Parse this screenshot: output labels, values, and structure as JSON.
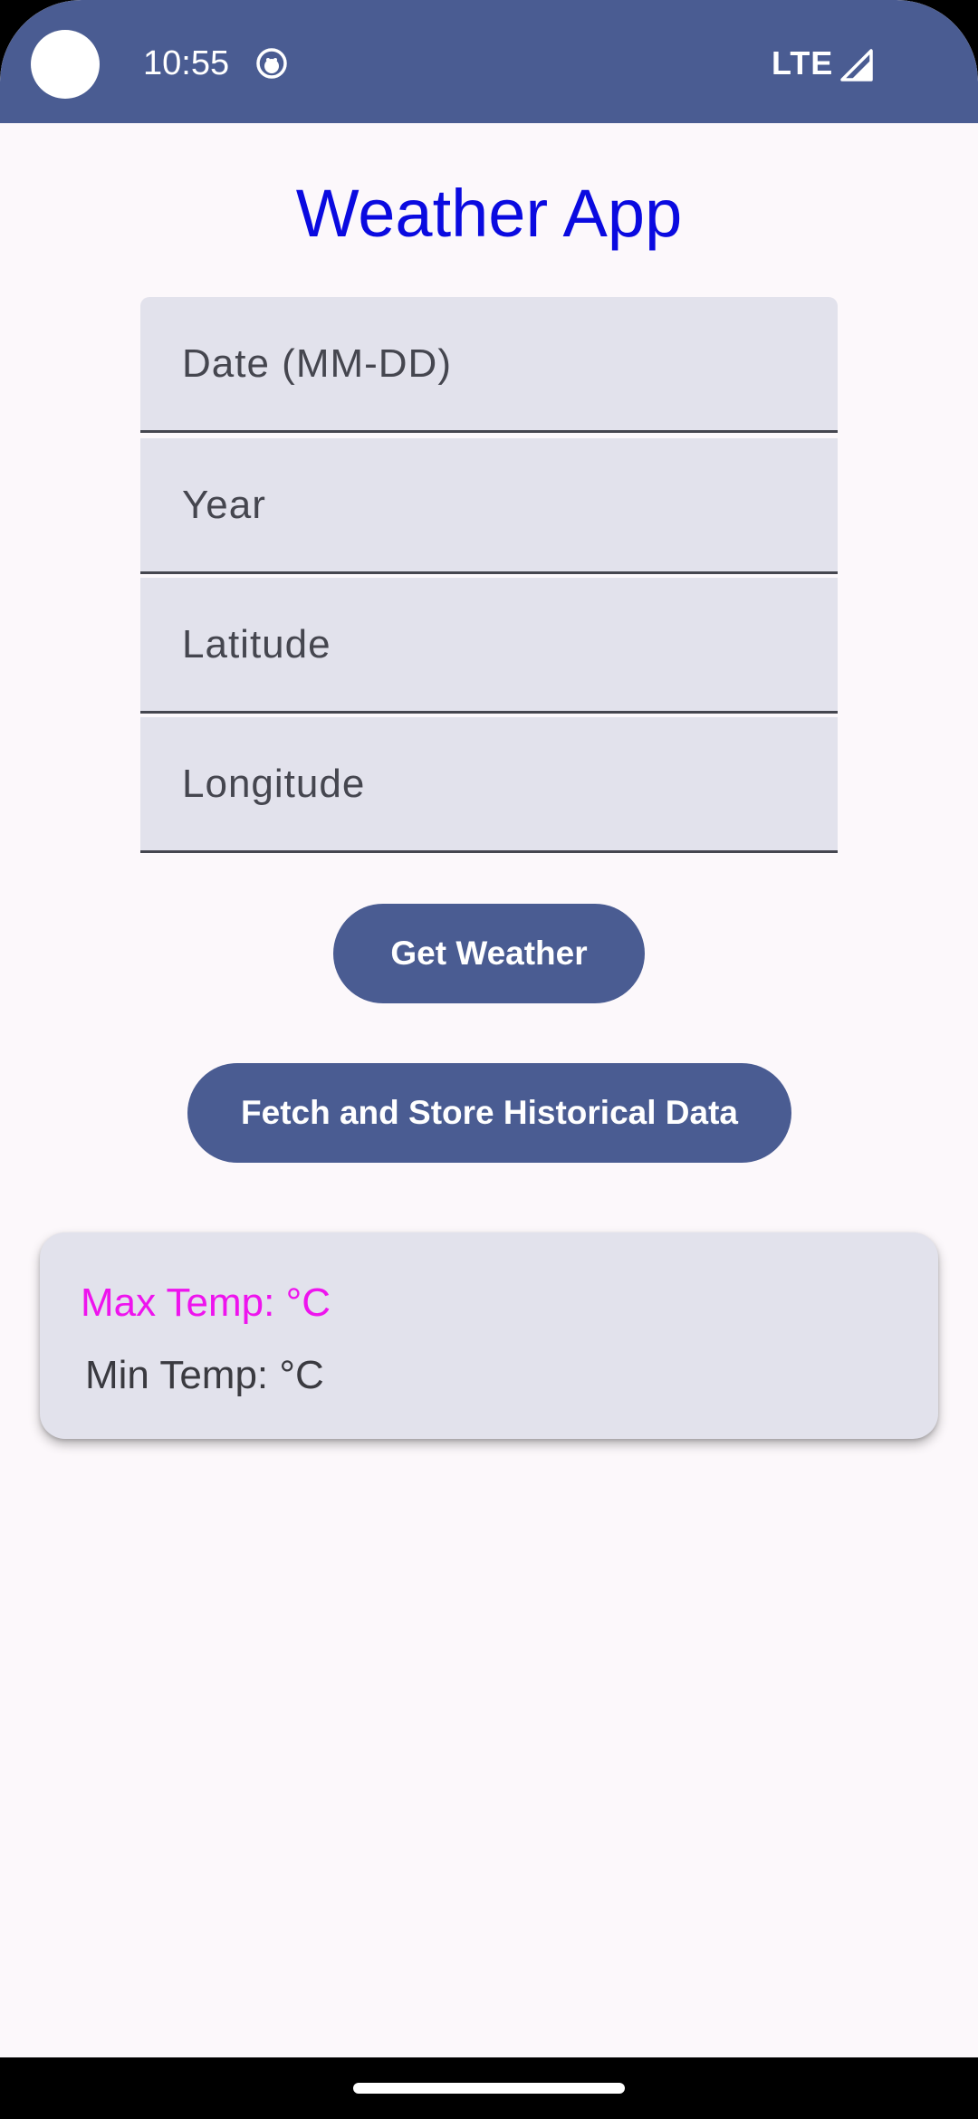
{
  "status_bar": {
    "time": "10:55",
    "network": "LTE",
    "icons": [
      "camera-cutout",
      "face-icon",
      "signal-icon"
    ]
  },
  "app": {
    "title": "Weather App"
  },
  "form": {
    "date_placeholder": "Date (MM-DD)",
    "year_placeholder": "Year",
    "latitude_placeholder": "Latitude",
    "longitude_placeholder": "Longitude",
    "date_value": "",
    "year_value": "",
    "latitude_value": "",
    "longitude_value": ""
  },
  "buttons": {
    "get_weather": "Get Weather",
    "fetch_store": "Fetch and Store Historical Data"
  },
  "result": {
    "max_temp": "Max Temp: °C",
    "min_temp": "Min Temp: °C"
  },
  "colors": {
    "primary": "#4A5C92",
    "title": "#0A0AE0",
    "max_temp": "#EE14EE",
    "surface": "#E2E2EC",
    "background": "#FCF8FB"
  }
}
